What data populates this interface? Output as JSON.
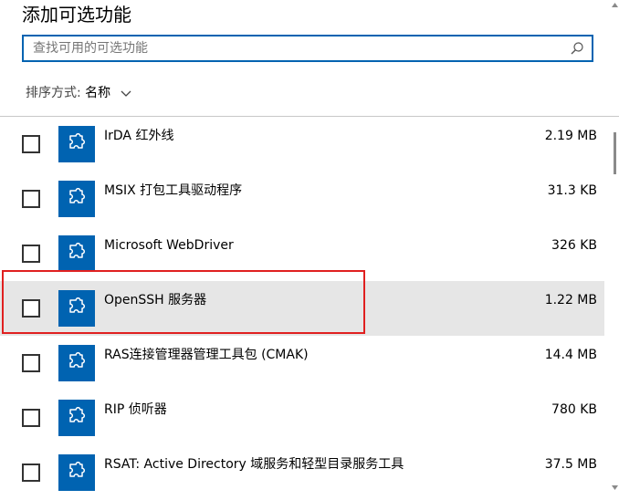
{
  "page": {
    "title": "添加可选功能",
    "search": {
      "placeholder": "查找可用的可选功能",
      "value": ""
    },
    "sort": {
      "label": "排序方式:",
      "value": "名称"
    }
  },
  "features": [
    {
      "name": "IrDA 红外线",
      "size": "2.19 MB",
      "checked": false
    },
    {
      "name": "MSIX 打包工具驱动程序",
      "size": "31.3 KB",
      "checked": false
    },
    {
      "name": "Microsoft WebDriver",
      "size": "326 KB",
      "checked": false
    },
    {
      "name": "OpenSSH 服务器",
      "size": "1.22 MB",
      "checked": false,
      "hovered": true
    },
    {
      "name": "RAS连接管理器管理工具包 (CMAK)",
      "size": "14.4 MB",
      "checked": false
    },
    {
      "name": "RIP 侦听器",
      "size": "780 KB",
      "checked": false
    },
    {
      "name": "RSAT: Active Directory 域服务和轻型目录服务工具",
      "size": "37.5 MB",
      "checked": false
    }
  ],
  "icons": {
    "feature": "puzzle-piece-icon",
    "search": "search-icon",
    "sort": "chevron-down-icon"
  },
  "colors": {
    "accent": "#0063b1",
    "hover_row": "#e6e6e6",
    "annotation": "#e02020"
  }
}
